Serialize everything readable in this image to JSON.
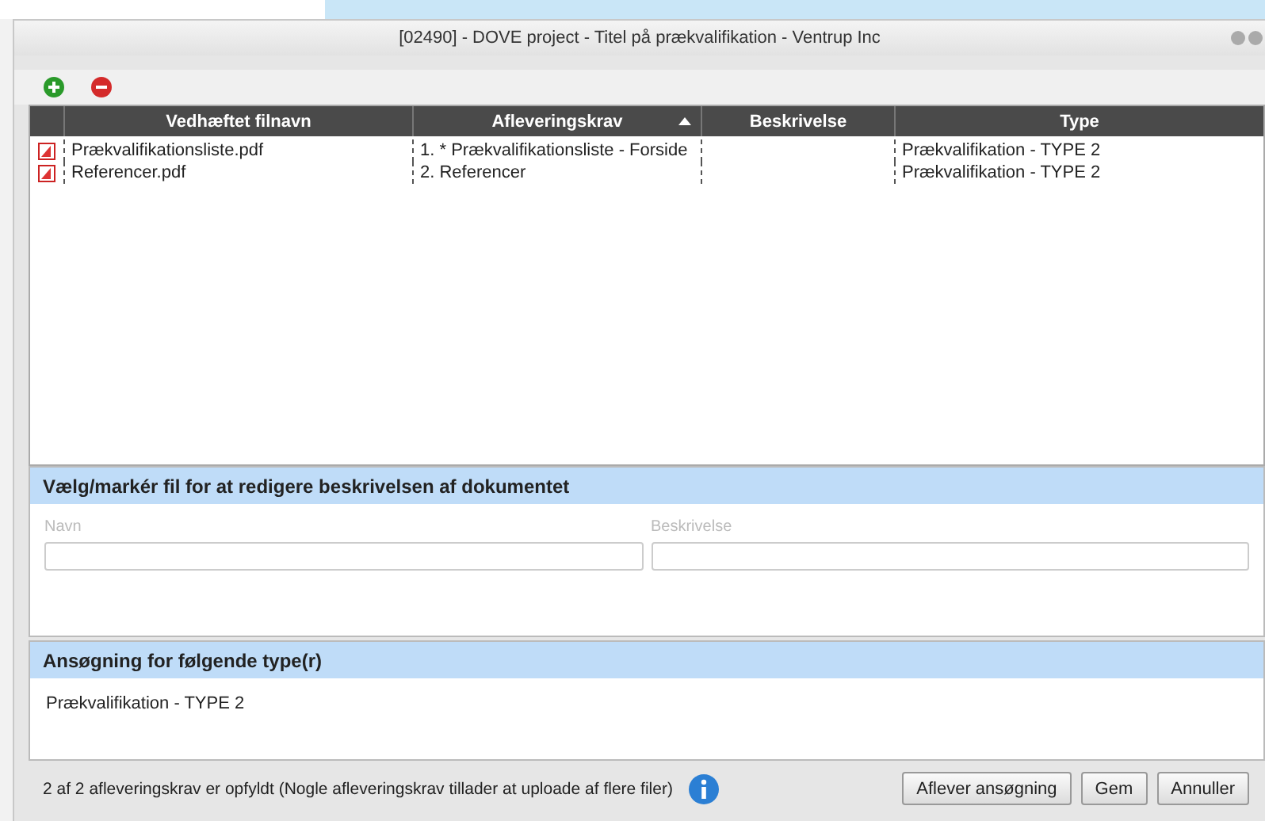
{
  "window": {
    "title": "[02490] - DOVE project - Titel på prækvalifikation - Ventrup Inc"
  },
  "table": {
    "columns": [
      {
        "label": "Vedhæftet filnavn",
        "sorted": false
      },
      {
        "label": "Afleveringskrav",
        "sorted": true
      },
      {
        "label": "Beskrivelse",
        "sorted": false
      },
      {
        "label": "Type",
        "sorted": false
      }
    ],
    "rows": [
      {
        "file": "Prækvalifikationsliste.pdf",
        "requirement": "1. * Prækvalifikationsliste - Forside",
        "description": "",
        "type": "Prækvalifikation - TYPE 2"
      },
      {
        "file": "Referencer.pdf",
        "requirement": "2. Referencer",
        "description": "",
        "type": "Prækvalifikation - TYPE 2"
      }
    ]
  },
  "edit_section": {
    "title": "Vælg/markér fil for at redigere beskrivelsen af dokumentet",
    "fields": [
      {
        "label": "Navn"
      },
      {
        "label": "Beskrivelse"
      }
    ]
  },
  "types_section": {
    "title": "Ansøgning for følgende type(r)",
    "items": [
      "Prækvalifikation - TYPE 2"
    ]
  },
  "status": "2 af 2 afleveringskrav er opfyldt (Nogle afleveringskrav tillader at uploade af flere filer)",
  "buttons": [
    "Aflever ansøgning",
    "Gem",
    "Annuller"
  ]
}
